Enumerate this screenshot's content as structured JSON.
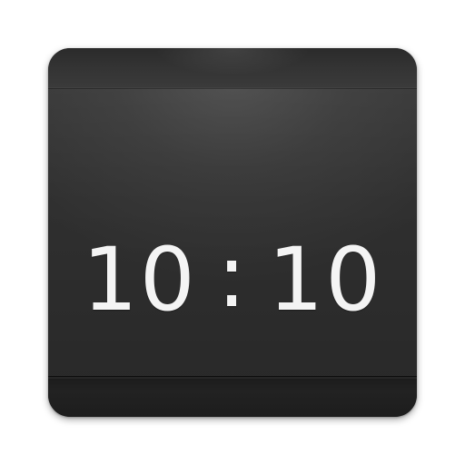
{
  "clock": {
    "hours": "10",
    "separator": ":",
    "minutes": "10"
  },
  "colors": {
    "page_background": "#ffffff",
    "icon_face": "#3a3a3a",
    "band_dark": "#1e1e1e",
    "digits": "#f4f4f4"
  }
}
